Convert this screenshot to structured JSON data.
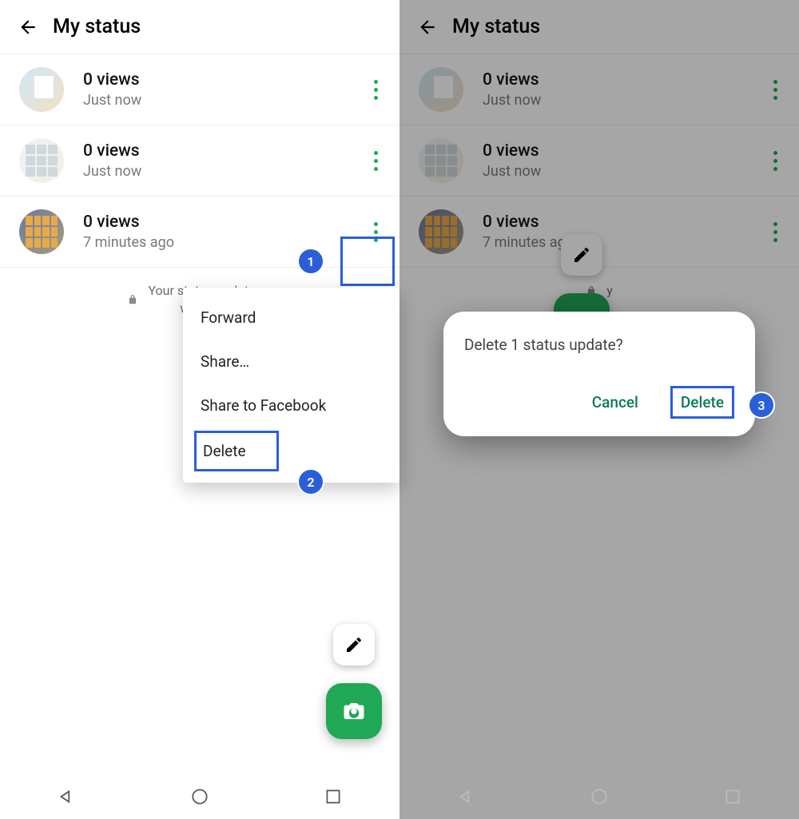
{
  "left": {
    "header": {
      "title": "My status"
    },
    "rows": [
      {
        "views": "0 views",
        "time": "Just now"
      },
      {
        "views": "0 views",
        "time": "Just now"
      },
      {
        "views": "0 views",
        "time": "7 minutes ago"
      }
    ],
    "note": "Your status updates are end-to-end encrypted. They will disappear after 24 hours.",
    "note_truncated": "Your status updates a\nwill disapp",
    "menu": {
      "forward": "Forward",
      "share": "Share…",
      "share_fb": "Share to Facebook",
      "delete": "Delete"
    },
    "badges": {
      "one": "1",
      "two": "2"
    }
  },
  "right": {
    "header": {
      "title": "My status"
    },
    "rows": [
      {
        "views": "0 views",
        "time": "Just now"
      },
      {
        "views": "0 views",
        "time": "Just now"
      },
      {
        "views": "0 views",
        "time": "7 minutes ago"
      }
    ],
    "dialog": {
      "message": "Delete 1 status update?",
      "cancel": "Cancel",
      "delete": "Delete"
    },
    "badge_three": "3"
  }
}
